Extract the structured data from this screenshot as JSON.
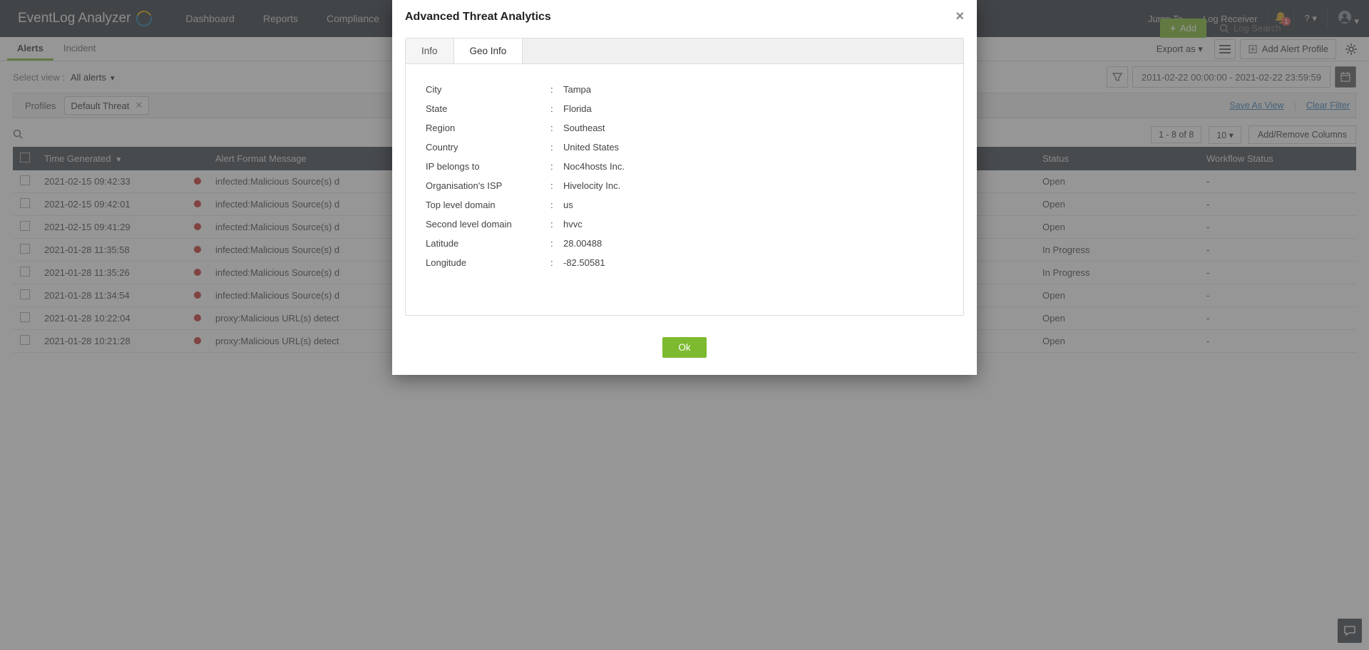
{
  "header": {
    "logo_text": "EventLog Analyzer",
    "nav": [
      "Dashboard",
      "Reports",
      "Compliance"
    ],
    "jump_to": "Jump To",
    "log_receiver": "Log Receiver",
    "notif_count": "1",
    "add_label": "Add",
    "search_placeholder": "Log Search"
  },
  "subnav": {
    "tabs": [
      "Alerts",
      "Incident"
    ],
    "export_as": "Export as",
    "add_alert_profile": "Add Alert Profile"
  },
  "filter": {
    "label": "Select view :",
    "value": "All alerts",
    "date_range": "2011-02-22 00:00:00 - 2021-02-22 23:59:59"
  },
  "chips": {
    "label": "Profiles",
    "value": "Default Threat",
    "save_as_view": "Save As View",
    "clear_filter": "Clear Filter"
  },
  "table": {
    "pager": "1 - 8 of 8",
    "pagesize": "10",
    "addcol": "Add/Remove Columns",
    "cols": {
      "time": "Time Generated",
      "msg": "Alert Format Message",
      "status": "Status",
      "workflow": "Workflow Status"
    },
    "rows": [
      {
        "time": "2021-02-15 09:42:33",
        "msg": "infected:Malicious Source(s) d",
        "status": "Open",
        "workflow": "-"
      },
      {
        "time": "2021-02-15 09:42:01",
        "msg": "infected:Malicious Source(s) d",
        "status": "Open",
        "workflow": "-"
      },
      {
        "time": "2021-02-15 09:41:29",
        "msg": "infected:Malicious Source(s) d",
        "status": "Open",
        "workflow": "-"
      },
      {
        "time": "2021-01-28 11:35:58",
        "msg": "infected:Malicious Source(s) d",
        "status": "In Progress",
        "workflow": "-"
      },
      {
        "time": "2021-01-28 11:35:26",
        "msg": "infected:Malicious Source(s) d",
        "status": "In Progress",
        "workflow": "-"
      },
      {
        "time": "2021-01-28 11:34:54",
        "msg": "infected:Malicious Source(s) d",
        "status": "Open",
        "workflow": "-"
      },
      {
        "time": "2021-01-28 10:22:04",
        "msg": "proxy:Malicious URL(s) detect",
        "status": "Open",
        "workflow": "-"
      },
      {
        "time": "2021-01-28 10:21:28",
        "msg": "proxy:Malicious URL(s) detect",
        "status": "Open",
        "workflow": "-"
      }
    ]
  },
  "modal": {
    "title": "Advanced Threat Analytics",
    "tabs": [
      "Info",
      "Geo Info"
    ],
    "active_tab": 1,
    "geo": [
      {
        "k": "City",
        "v": "Tampa"
      },
      {
        "k": "State",
        "v": "Florida"
      },
      {
        "k": "Region",
        "v": "Southeast"
      },
      {
        "k": "Country",
        "v": "United States"
      },
      {
        "k": "IP belongs to",
        "v": "Noc4hosts Inc."
      },
      {
        "k": "Organisation's ISP",
        "v": "Hivelocity Inc."
      },
      {
        "k": "Top level domain",
        "v": "us"
      },
      {
        "k": "Second level domain",
        "v": "hvvc"
      },
      {
        "k": "Latitude",
        "v": "28.00488"
      },
      {
        "k": "Longitude",
        "v": "-82.50581"
      }
    ],
    "ok": "Ok"
  }
}
